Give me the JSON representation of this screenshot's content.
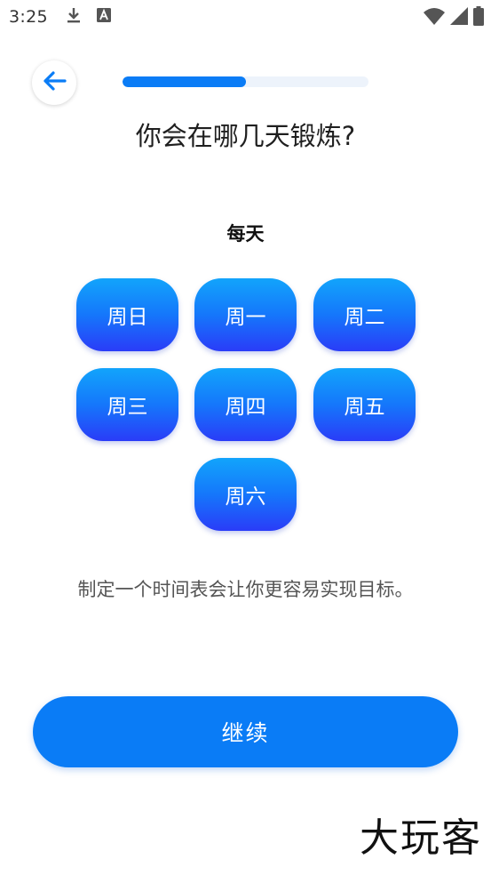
{
  "status_bar": {
    "time": "3:25",
    "left_icons": [
      "download-icon",
      "a-badge-icon"
    ],
    "right_icons": [
      "wifi-icon",
      "signal-icon",
      "battery-icon"
    ]
  },
  "header": {
    "back_icon": "arrow-left-icon",
    "progress": 0.5
  },
  "question": "你会在哪几天锻炼?",
  "everyday_label": "每天",
  "days": [
    "周日",
    "周一",
    "周二",
    "周三",
    "周四",
    "周五",
    "周六"
  ],
  "hint": "制定一个时间表会让你更容易实现目标。",
  "continue_label": "继续",
  "watermark": "大玩客",
  "colors": {
    "primary": "#0a7cf6",
    "day_gradient_top": "#12a4fb",
    "day_gradient_bottom": "#2a3cf8",
    "track": "#edf3fb"
  }
}
